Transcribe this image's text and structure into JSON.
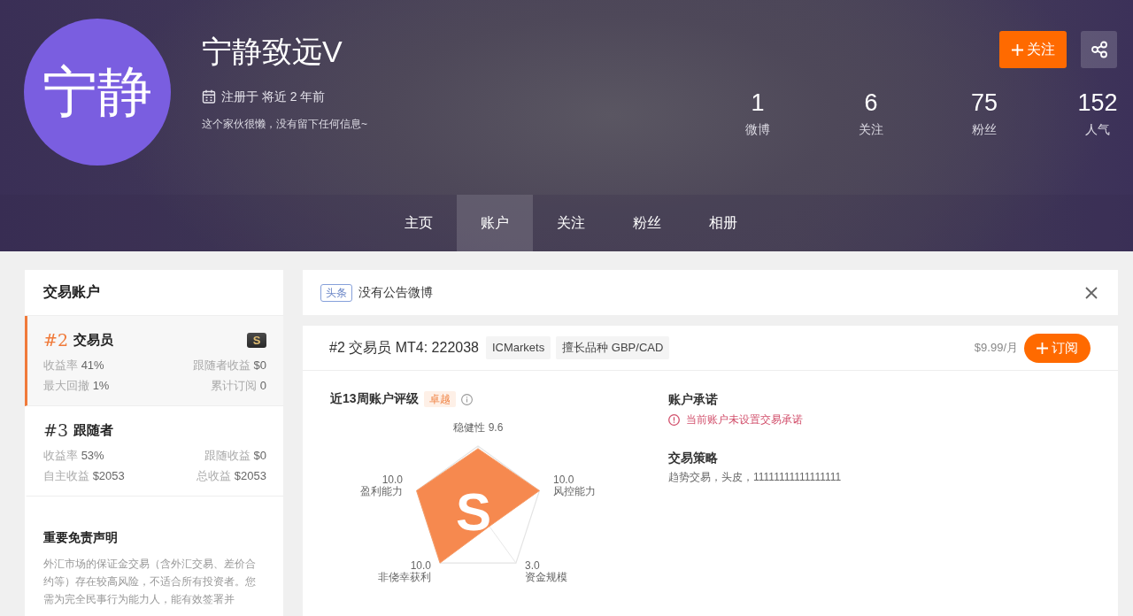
{
  "profile": {
    "avatar_text": "宁静",
    "name": "宁静致远V",
    "registered": "注册于 将近 2 年前",
    "bio": "这个家伙很懒，没有留下任何信息~",
    "follow_button": "关注",
    "stats": [
      {
        "value": "1",
        "label": "微博"
      },
      {
        "value": "6",
        "label": "关注"
      },
      {
        "value": "75",
        "label": "粉丝"
      },
      {
        "value": "152",
        "label": "人气"
      }
    ]
  },
  "tabs": [
    {
      "label": "主页",
      "selected": false
    },
    {
      "label": "账户",
      "selected": true
    },
    {
      "label": "关注",
      "selected": false
    },
    {
      "label": "粉丝",
      "selected": false
    },
    {
      "label": "相册",
      "selected": false
    }
  ],
  "sidebar": {
    "title": "交易账户",
    "accounts": [
      {
        "number": "#2",
        "role": "交易员",
        "selected": true,
        "badge": "S",
        "metrics": [
          {
            "label": "收益率",
            "value": "41%"
          },
          {
            "label": "跟随者收益",
            "value": "$0"
          },
          {
            "label": "最大回撤",
            "value": "1%"
          },
          {
            "label": "累计订阅",
            "value": "0"
          }
        ]
      },
      {
        "number": "#3",
        "role": "跟随者",
        "selected": false,
        "metrics": [
          {
            "label": "收益率",
            "value": "53%"
          },
          {
            "label": "跟随收益",
            "value": "$0"
          },
          {
            "label": "自主收益",
            "value": "$2053"
          },
          {
            "label": "总收益",
            "value": "$2053"
          }
        ]
      }
    ],
    "disclaimer": {
      "title": "重要免责声明",
      "text": "外汇市场的保证金交易（含外汇交易、差价合约等）存在较高风险，不适合所有投资者。您需为完全民事行为能力人，能有效签署并"
    }
  },
  "notice": {
    "tag": "头条",
    "text": "没有公告微博"
  },
  "account": {
    "title": "#2 交易员 MT4: 222038",
    "tags": [
      "ICMarkets",
      "擅长品种 GBP/CAD"
    ],
    "price": "$9.99/月",
    "subscribe_button": "订阅",
    "rating": {
      "title": "近13周账户评级",
      "level_badge": "卓越",
      "grade": "S",
      "axes": [
        {
          "name": "稳健性",
          "value": "9.6"
        },
        {
          "name": "盈利能力",
          "value": "10.0"
        },
        {
          "name": "风控能力",
          "value": "10.0"
        },
        {
          "name": "非侥幸获利",
          "value": "10.0"
        },
        {
          "name": "资金规模",
          "value": "3.0"
        }
      ]
    },
    "commitment": {
      "title": "账户承诺",
      "warning": "当前账户未设置交易承诺"
    },
    "strategy": {
      "title": "交易策略",
      "text": "趋势交易，头皮，11111111111111111"
    }
  }
}
